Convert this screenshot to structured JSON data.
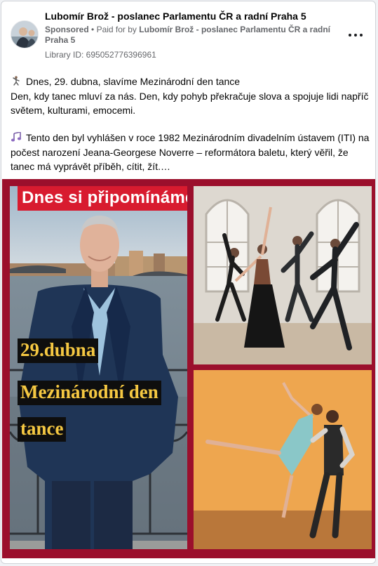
{
  "post": {
    "author": "Lubomír Brož - poslanec Parlamentu ČR a radní Praha 5",
    "sponsored_label": "Sponsored",
    "separator": "•",
    "paid_for_prefix": "Paid for by",
    "paid_by": "Lubomír Brož - poslanec Parlamentu ČR a radní Praha 5",
    "library_id": "Library ID: 695052776396961",
    "paragraph1_line1": "Dnes, 29. dubna, slavíme Mezinárodní den tance",
    "paragraph1_line2": "Den, kdy tanec mluví za nás. Den, kdy pohyb překračuje slova a spojuje lidi napříč světem, kulturami, emocemi.",
    "paragraph2": "Tento den byl vyhlášen v roce 1982 Mezinárodním divadelním ústavem (ITI) na počest narození Jeana-Georgese Noverre – reformátora baletu, který věřil, že tanec má vyprávět příběh, cítit, žít.…",
    "emoji1": "dancer-emoji",
    "emoji2": "music-notes-emoji"
  },
  "image": {
    "overlay_top": "Dnes si připomínáme",
    "overlay_date": "29.dubna",
    "overlay_line1": "Mezinárodní den",
    "overlay_line2": "tance",
    "frame_color": "#9b0f2c",
    "overlay_red": "#d81b2f",
    "overlay_yellow": "#f5c842"
  }
}
